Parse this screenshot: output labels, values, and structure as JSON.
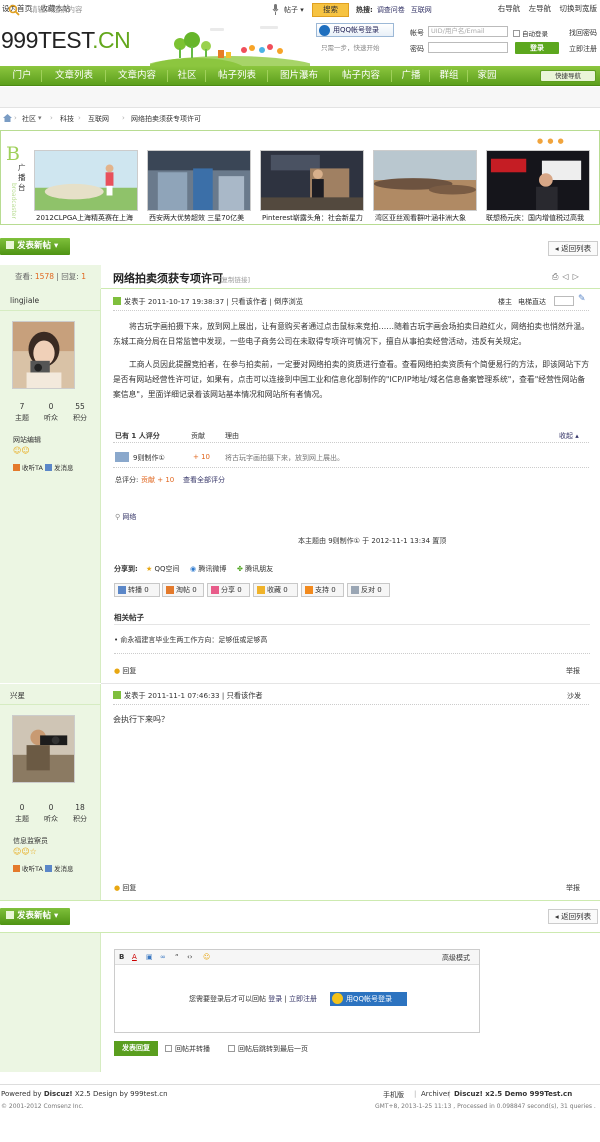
{
  "topbar": {
    "set_home": "设为首页",
    "bookmark": "收藏本站",
    "right_nav": "右导航",
    "left_nav": "左导航",
    "switch_width": "切换到宽版"
  },
  "header": {
    "logo_a": "999TEST",
    "logo_b": ".CN",
    "qq_login": "用QQ帐号登录",
    "qq_tip": "只需一步，快速开始",
    "account_label": "帐号",
    "account_placeholder": "UID/用户名/Email",
    "password_label": "密码",
    "auto_login": "自动登录",
    "login_button": "登录",
    "find_password": "找回密码",
    "register": "立即注册"
  },
  "nav": {
    "items": [
      "门户",
      "文章列表",
      "文章内容",
      "社区",
      "帖子列表",
      "图片瀑布",
      "帖子内容",
      "广播",
      "群组",
      "家园"
    ],
    "quick_nav": "快捷导航"
  },
  "search": {
    "placeholder": "请输入搜索内容",
    "scope": "帖子",
    "button": "搜索",
    "hot_label": "热搜:",
    "hot": [
      "调查问卷",
      "互联网"
    ]
  },
  "breadcrumb": [
    "社区",
    "科技",
    "互联网",
    "网络拍卖须获专项许可"
  ],
  "broadcast": {
    "title_big": "B",
    "title_cn": "广播台",
    "title_en": "broadcaster",
    "dots": "● ● ●",
    "captions": [
      "2012CLPGA上海精英赛在上海",
      "西安两大优势超效 三星70亿美",
      "Pinterest崭露头角：社会新星力",
      "湾区亚丝观看群叶涵非洲大象",
      "联想杨元庆：国内增值税过高我"
    ]
  },
  "actions": {
    "new_post": "发表新帖",
    "back_list": "返回列表"
  },
  "thread": {
    "views_label": "查看:",
    "views": "1578",
    "replies_label": "回复:",
    "replies": "1",
    "title": "网络拍卖须获专项许可",
    "copy_link": "[复制链接]"
  },
  "post1": {
    "author": "lingjiale",
    "stats": [
      {
        "n": "7",
        "l": "主题"
      },
      {
        "n": "0",
        "l": "听众"
      },
      {
        "n": "55",
        "l": "积分"
      }
    ],
    "group": "网站编辑",
    "follow": "收听TA",
    "message": "发消息",
    "meta": "发表于 2011-10-17 19:38:37",
    "only_author": "只看该作者",
    "reverse": "倒序浏览",
    "floor": "楼主",
    "floor_jump": "电梯直达",
    "para1": "将古玩字画拍摄下来，放到网上展出，让有意购买者通过点击鼠标来竞拍……随着古玩字画会场拍卖日趋红火，网络拍卖也悄然升温。东城工商分局在日常监管中发现，一些电子商务公司在未取得专项许可情况下，擅自从事拍卖经营活动，违反有关规定。",
    "para2": "工商人员因此提醒竞拍者，在参与拍卖前，一定要对网络拍卖的资质进行查看。查看网络拍卖资质有个简便易行的方法，即该网站下方是否有网站经营性许可证，如果有，点击可以连接到中国工业和信息化部制作的\"ICP/IP地址/域名信息备案管理系统\"，查看\"经营性网站备案信息\"，里面详细记录着该网站基本情况和网站所有者情况。",
    "rate_head": "已有 1 人评分",
    "rate_col1": "贡献",
    "rate_col2": "理由",
    "rate_collapse": "收起 ▴",
    "rater": "9则制作①",
    "rate_value": "+ 10",
    "rate_reason": "将古玩字画拍摄下来，放到网上展出。",
    "total_label": "总评分:",
    "total_value": "贡献 + 10",
    "view_all": "查看全部评分",
    "tag": "网络",
    "edit_note": "本主题由 9则制作① 于 2012-11-1 13:34 置顶",
    "share_label": "分享到:",
    "share": [
      "QQ空间",
      "腾讯微博",
      "腾讯朋友"
    ],
    "buttons": [
      "转播 0",
      "淘帖 0",
      "分享 0",
      "收藏 0",
      "支持 0",
      "反对 0"
    ],
    "related_title": "相关帖子",
    "related": [
      "• 俞永福建言毕业生两工作方向：足够低或足够高"
    ],
    "reply": "回复",
    "report": "举报"
  },
  "post2": {
    "author": "兴星",
    "stats": [
      {
        "n": "0",
        "l": "主题"
      },
      {
        "n": "0",
        "l": "听众"
      },
      {
        "n": "18",
        "l": "积分"
      }
    ],
    "group": "信息监察员",
    "follow": "收听TA",
    "message": "发消息",
    "meta": "发表于 2011-11-1 07:46:33",
    "only_author": "只看该作者",
    "floor": "沙发",
    "content": "会执行下来吗？",
    "reply": "回复",
    "report": "举报"
  },
  "reply_box": {
    "advanced": "高级模式",
    "need_login": "您需要登录后才可以回帖",
    "login": "登录",
    "register": "立即注册",
    "qq_login": "用QQ帐号登录",
    "submit": "发表回复",
    "opt1": "回帖并转播",
    "opt2": "回帖后跳转到最后一页"
  },
  "footer": {
    "powered": "Powered by",
    "discuz": "Discuz!",
    "version": "X2.5 Design by 999test.cn",
    "copyright": "© 2001-2012 Comsenz Inc.",
    "links": [
      "手机版",
      "Archiver"
    ],
    "demo": "Discuz! x2.5 Demo 999Test.cn",
    "gmt": "GMT+8, 2013-1-25 11:13 , Processed in 0.098847 second(s), 31 queries ."
  }
}
